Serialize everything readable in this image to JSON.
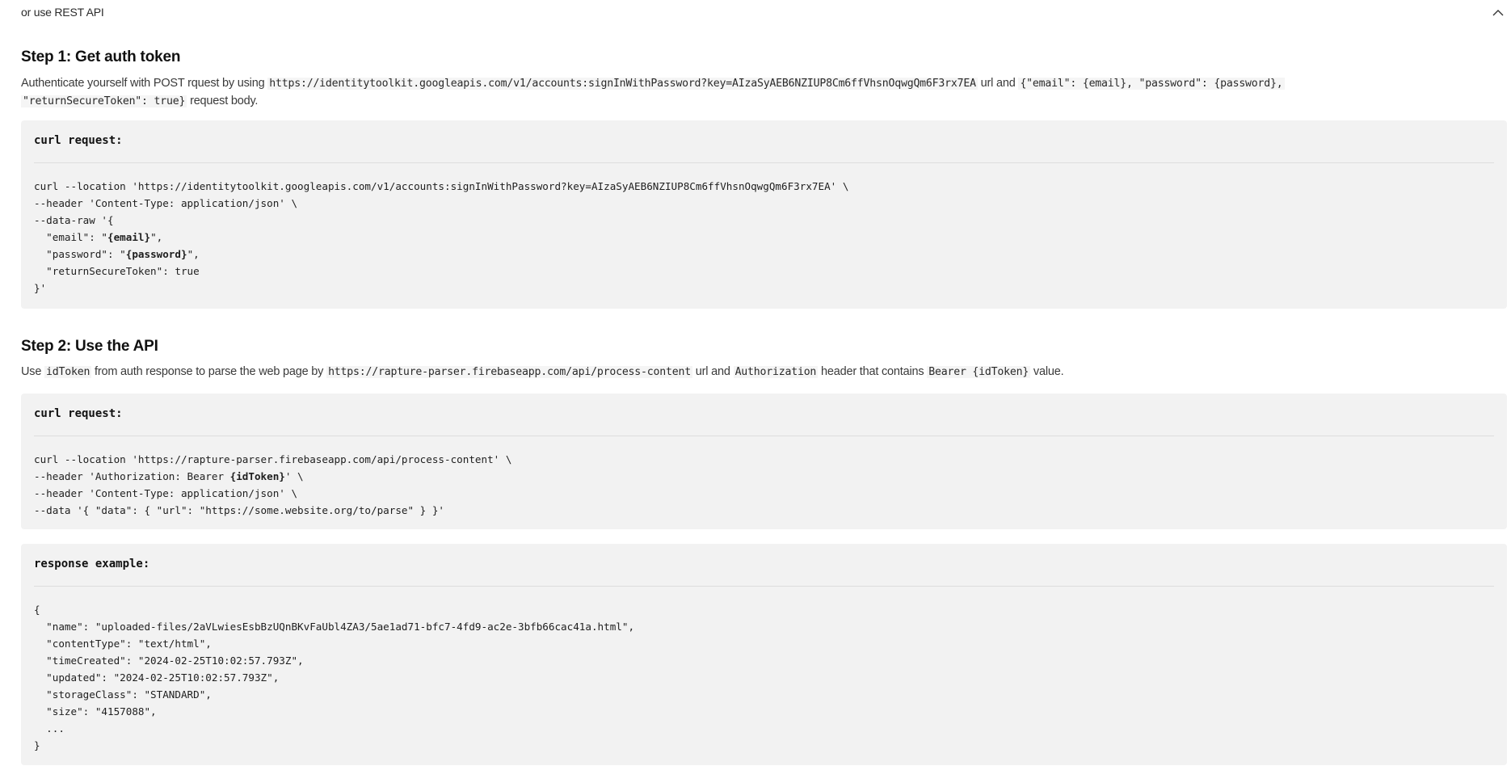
{
  "accordion": {
    "title": "or use REST API"
  },
  "step1": {
    "heading": "Step 1: Get auth token",
    "desc_pre": "Authenticate yourself with POST rquest by using ",
    "url": "https://identitytoolkit.googleapis.com/v1/accounts:signInWithPassword?key=AIzaSyAEB6NZIUP8Cm6ffVhsnOqwgQm6F3rx7EA",
    "desc_mid": " url and ",
    "body_line1": "{\"email\": {email}, \"password\": {password},",
    "body_line2": "\"returnSecureToken\": true}",
    "desc_post": " request body.",
    "code": {
      "label": "curl request:",
      "lines": [
        {
          "pre": "curl --location 'https://identitytoolkit.googleapis.com/v1/accounts:signInWithPassword?key=AIzaSyAEB6NZIUP8Cm6ffVhsnOqwgQm6F3rx7EA' \\",
          "bold": "",
          "post": ""
        },
        {
          "pre": "--header 'Content-Type: application/json' \\",
          "bold": "",
          "post": ""
        },
        {
          "pre": "--data-raw '{",
          "bold": "",
          "post": ""
        },
        {
          "pre": "  \"email\": \"",
          "bold": "{email}",
          "post": "\","
        },
        {
          "pre": "  \"password\": \"",
          "bold": "{password}",
          "post": "\","
        },
        {
          "pre": "  \"returnSecureToken\": true",
          "bold": "",
          "post": ""
        },
        {
          "pre": "}'",
          "bold": "",
          "post": ""
        }
      ]
    }
  },
  "step2": {
    "heading": "Step 2: Use the API",
    "desc_1": "Use ",
    "token": "idToken",
    "desc_2": " from auth response to parse the web page by ",
    "url": "https://rapture-parser.firebaseapp.com/api/process-content",
    "desc_3": " url and ",
    "header_name": "Authorization",
    "desc_4": " header that contains ",
    "header_value": "Bearer {idToken}",
    "desc_5": " value.",
    "code": {
      "label": "curl request:",
      "lines": [
        {
          "pre": "curl --location 'https://rapture-parser.firebaseapp.com/api/process-content' \\",
          "bold": "",
          "post": ""
        },
        {
          "pre": "--header 'Authorization: Bearer ",
          "bold": "{idToken}",
          "post": "' \\"
        },
        {
          "pre": "--header 'Content-Type: application/json' \\",
          "bold": "",
          "post": ""
        },
        {
          "pre": "--data '{ \"data\": { \"url\": \"https://some.website.org/to/parse\" } }'",
          "bold": "",
          "post": ""
        }
      ]
    },
    "response": {
      "label": "response example:",
      "lines": [
        {
          "pre": "{",
          "bold": "",
          "post": ""
        },
        {
          "pre": "  \"name\": \"uploaded-files/2aVLwiesEsbBzUQnBKvFaUbl4ZA3/5ae1ad71-bfc7-4fd9-ac2e-3bfb66cac41a.html\",",
          "bold": "",
          "post": ""
        },
        {
          "pre": "  \"contentType\": \"text/html\",",
          "bold": "",
          "post": ""
        },
        {
          "pre": "  \"timeCreated\": \"2024-02-25T10:02:57.793Z\",",
          "bold": "",
          "post": ""
        },
        {
          "pre": "  \"updated\": \"2024-02-25T10:02:57.793Z\",",
          "bold": "",
          "post": ""
        },
        {
          "pre": "  \"storageClass\": \"STANDARD\",",
          "bold": "",
          "post": ""
        },
        {
          "pre": "  \"size\": \"4157088\",",
          "bold": "",
          "post": ""
        },
        {
          "pre": "  ...",
          "bold": "",
          "post": ""
        },
        {
          "pre": "}",
          "bold": "",
          "post": ""
        }
      ]
    }
  },
  "icons": {
    "collapse": "chevron-up-icon"
  }
}
